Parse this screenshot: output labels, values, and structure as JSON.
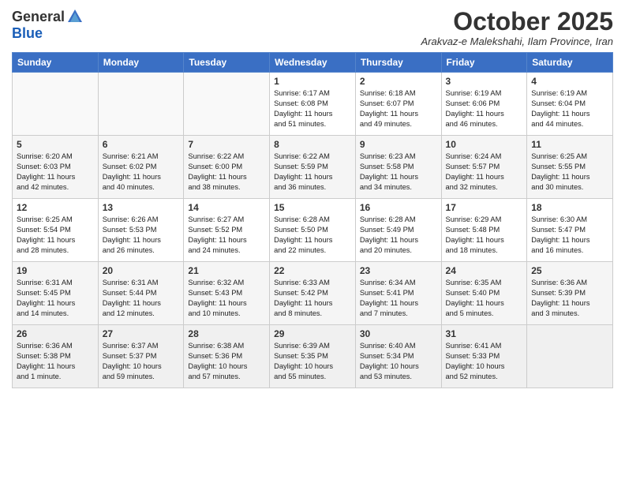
{
  "logo": {
    "general": "General",
    "blue": "Blue"
  },
  "title": "October 2025",
  "subtitle": "Arakvaz-e Malekshahi, Ilam Province, Iran",
  "weekdays": [
    "Sunday",
    "Monday",
    "Tuesday",
    "Wednesday",
    "Thursday",
    "Friday",
    "Saturday"
  ],
  "weeks": [
    [
      {
        "day": "",
        "info": ""
      },
      {
        "day": "",
        "info": ""
      },
      {
        "day": "",
        "info": ""
      },
      {
        "day": "1",
        "info": "Sunrise: 6:17 AM\nSunset: 6:08 PM\nDaylight: 11 hours\nand 51 minutes."
      },
      {
        "day": "2",
        "info": "Sunrise: 6:18 AM\nSunset: 6:07 PM\nDaylight: 11 hours\nand 49 minutes."
      },
      {
        "day": "3",
        "info": "Sunrise: 6:19 AM\nSunset: 6:06 PM\nDaylight: 11 hours\nand 46 minutes."
      },
      {
        "day": "4",
        "info": "Sunrise: 6:19 AM\nSunset: 6:04 PM\nDaylight: 11 hours\nand 44 minutes."
      }
    ],
    [
      {
        "day": "5",
        "info": "Sunrise: 6:20 AM\nSunset: 6:03 PM\nDaylight: 11 hours\nand 42 minutes."
      },
      {
        "day": "6",
        "info": "Sunrise: 6:21 AM\nSunset: 6:02 PM\nDaylight: 11 hours\nand 40 minutes."
      },
      {
        "day": "7",
        "info": "Sunrise: 6:22 AM\nSunset: 6:00 PM\nDaylight: 11 hours\nand 38 minutes."
      },
      {
        "day": "8",
        "info": "Sunrise: 6:22 AM\nSunset: 5:59 PM\nDaylight: 11 hours\nand 36 minutes."
      },
      {
        "day": "9",
        "info": "Sunrise: 6:23 AM\nSunset: 5:58 PM\nDaylight: 11 hours\nand 34 minutes."
      },
      {
        "day": "10",
        "info": "Sunrise: 6:24 AM\nSunset: 5:57 PM\nDaylight: 11 hours\nand 32 minutes."
      },
      {
        "day": "11",
        "info": "Sunrise: 6:25 AM\nSunset: 5:55 PM\nDaylight: 11 hours\nand 30 minutes."
      }
    ],
    [
      {
        "day": "12",
        "info": "Sunrise: 6:25 AM\nSunset: 5:54 PM\nDaylight: 11 hours\nand 28 minutes."
      },
      {
        "day": "13",
        "info": "Sunrise: 6:26 AM\nSunset: 5:53 PM\nDaylight: 11 hours\nand 26 minutes."
      },
      {
        "day": "14",
        "info": "Sunrise: 6:27 AM\nSunset: 5:52 PM\nDaylight: 11 hours\nand 24 minutes."
      },
      {
        "day": "15",
        "info": "Sunrise: 6:28 AM\nSunset: 5:50 PM\nDaylight: 11 hours\nand 22 minutes."
      },
      {
        "day": "16",
        "info": "Sunrise: 6:28 AM\nSunset: 5:49 PM\nDaylight: 11 hours\nand 20 minutes."
      },
      {
        "day": "17",
        "info": "Sunrise: 6:29 AM\nSunset: 5:48 PM\nDaylight: 11 hours\nand 18 minutes."
      },
      {
        "day": "18",
        "info": "Sunrise: 6:30 AM\nSunset: 5:47 PM\nDaylight: 11 hours\nand 16 minutes."
      }
    ],
    [
      {
        "day": "19",
        "info": "Sunrise: 6:31 AM\nSunset: 5:45 PM\nDaylight: 11 hours\nand 14 minutes."
      },
      {
        "day": "20",
        "info": "Sunrise: 6:31 AM\nSunset: 5:44 PM\nDaylight: 11 hours\nand 12 minutes."
      },
      {
        "day": "21",
        "info": "Sunrise: 6:32 AM\nSunset: 5:43 PM\nDaylight: 11 hours\nand 10 minutes."
      },
      {
        "day": "22",
        "info": "Sunrise: 6:33 AM\nSunset: 5:42 PM\nDaylight: 11 hours\nand 8 minutes."
      },
      {
        "day": "23",
        "info": "Sunrise: 6:34 AM\nSunset: 5:41 PM\nDaylight: 11 hours\nand 7 minutes."
      },
      {
        "day": "24",
        "info": "Sunrise: 6:35 AM\nSunset: 5:40 PM\nDaylight: 11 hours\nand 5 minutes."
      },
      {
        "day": "25",
        "info": "Sunrise: 6:36 AM\nSunset: 5:39 PM\nDaylight: 11 hours\nand 3 minutes."
      }
    ],
    [
      {
        "day": "26",
        "info": "Sunrise: 6:36 AM\nSunset: 5:38 PM\nDaylight: 11 hours\nand 1 minute."
      },
      {
        "day": "27",
        "info": "Sunrise: 6:37 AM\nSunset: 5:37 PM\nDaylight: 10 hours\nand 59 minutes."
      },
      {
        "day": "28",
        "info": "Sunrise: 6:38 AM\nSunset: 5:36 PM\nDaylight: 10 hours\nand 57 minutes."
      },
      {
        "day": "29",
        "info": "Sunrise: 6:39 AM\nSunset: 5:35 PM\nDaylight: 10 hours\nand 55 minutes."
      },
      {
        "day": "30",
        "info": "Sunrise: 6:40 AM\nSunset: 5:34 PM\nDaylight: 10 hours\nand 53 minutes."
      },
      {
        "day": "31",
        "info": "Sunrise: 6:41 AM\nSunset: 5:33 PM\nDaylight: 10 hours\nand 52 minutes."
      },
      {
        "day": "",
        "info": ""
      }
    ]
  ]
}
